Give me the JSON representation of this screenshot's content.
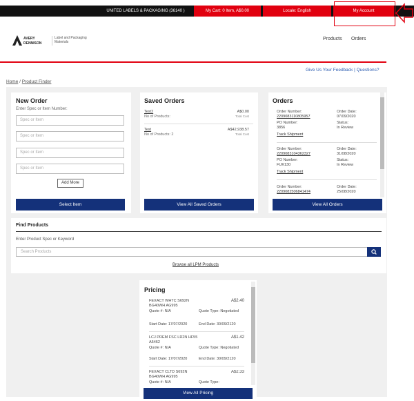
{
  "topbar": {
    "company": "UNITED LABELS & PACKAGING (36140 )",
    "cart": "My Cart: 0 Item,  A$0.00",
    "locale": "Locale: English",
    "account": "My Account"
  },
  "header": {
    "logo_text": "AVERY DENNISON",
    "logo_sub": "Label and Packaging Materials",
    "nav": [
      "Products",
      "Orders"
    ]
  },
  "feedback": "Give Us Your Feedback | Questions?",
  "breadcrumb": [
    "Home",
    "Product Finder"
  ],
  "new_order": {
    "title": "New Order",
    "hint": "Enter Spec or Item Number:",
    "placeholder": "Spec or Item",
    "add_more": "Add More",
    "select_item": "Select Item"
  },
  "saved_orders": {
    "title": "Saved Orders",
    "items": [
      {
        "name": "Test2",
        "count": "No of Products:",
        "amount": "A$0.00",
        "label": "Total Cost"
      },
      {
        "name": "Test",
        "count": "No of Products:  2",
        "amount": "A$42,938.57",
        "label": "Total Cost"
      }
    ],
    "button": "View All Saved Orders"
  },
  "orders": {
    "title": "Orders",
    "items": [
      {
        "num_label": "Order Number:",
        "num": "2209083110805957",
        "po_label": "PO Number:",
        "po": "3856",
        "track": "Track Shipment",
        "date_label": "Order Date:",
        "date": "07/09/2020",
        "status_label": "Status:",
        "status": "In Review"
      },
      {
        "num_label": "Order Number:",
        "num": "2209083104362327",
        "po_label": "PO Number:",
        "po": "FUK130",
        "track": "Track Shipment",
        "date_label": "Order Date:",
        "date": "31/08/2020",
        "status_label": "Status:",
        "status": "In Review"
      },
      {
        "num_label": "Order Number:",
        "num": "2209082506841474",
        "po_label": "",
        "po": "",
        "track": "",
        "date_label": "Order Date:",
        "date": "25/08/2020",
        "status_label": "",
        "status": ""
      }
    ],
    "button": "View All Orders"
  },
  "find_products": {
    "title": "Find Products",
    "hint": "Enter Product Spec or Keyword",
    "placeholder": "Search Products",
    "browse": "Browse all LPM Products"
  },
  "pricing": {
    "title": "Pricing",
    "items": [
      {
        "name": "FEXACT WHTC S692N BG40WH AG995",
        "price": "A$2.40",
        "quote": "Quote #: N/A",
        "quote_type": "Quote Type: Negotiated",
        "start": "Start Date: 17/07/2020",
        "end": "End Date: 30/09/2120"
      },
      {
        "name": "LCJ PREM FSC LR2N HF55 A5462",
        "price": "A$1.42",
        "quote": "Quote #: N/A",
        "quote_type": "Quote Type: Negotiated",
        "start": "Start Date: 17/07/2020",
        "end": "End Date: 30/09/2120"
      },
      {
        "name": "FEXACT CLTD S692N BG40WH AG995",
        "price": "A$2.33",
        "quote": "Quote #: N/A",
        "quote_type": "Quote Type:",
        "start": "",
        "end": ""
      }
    ],
    "button": "View All Pricing"
  },
  "colors": {
    "brand_red": "#e1000f",
    "navy": "#14317a",
    "link_blue": "#2a5bb0"
  }
}
